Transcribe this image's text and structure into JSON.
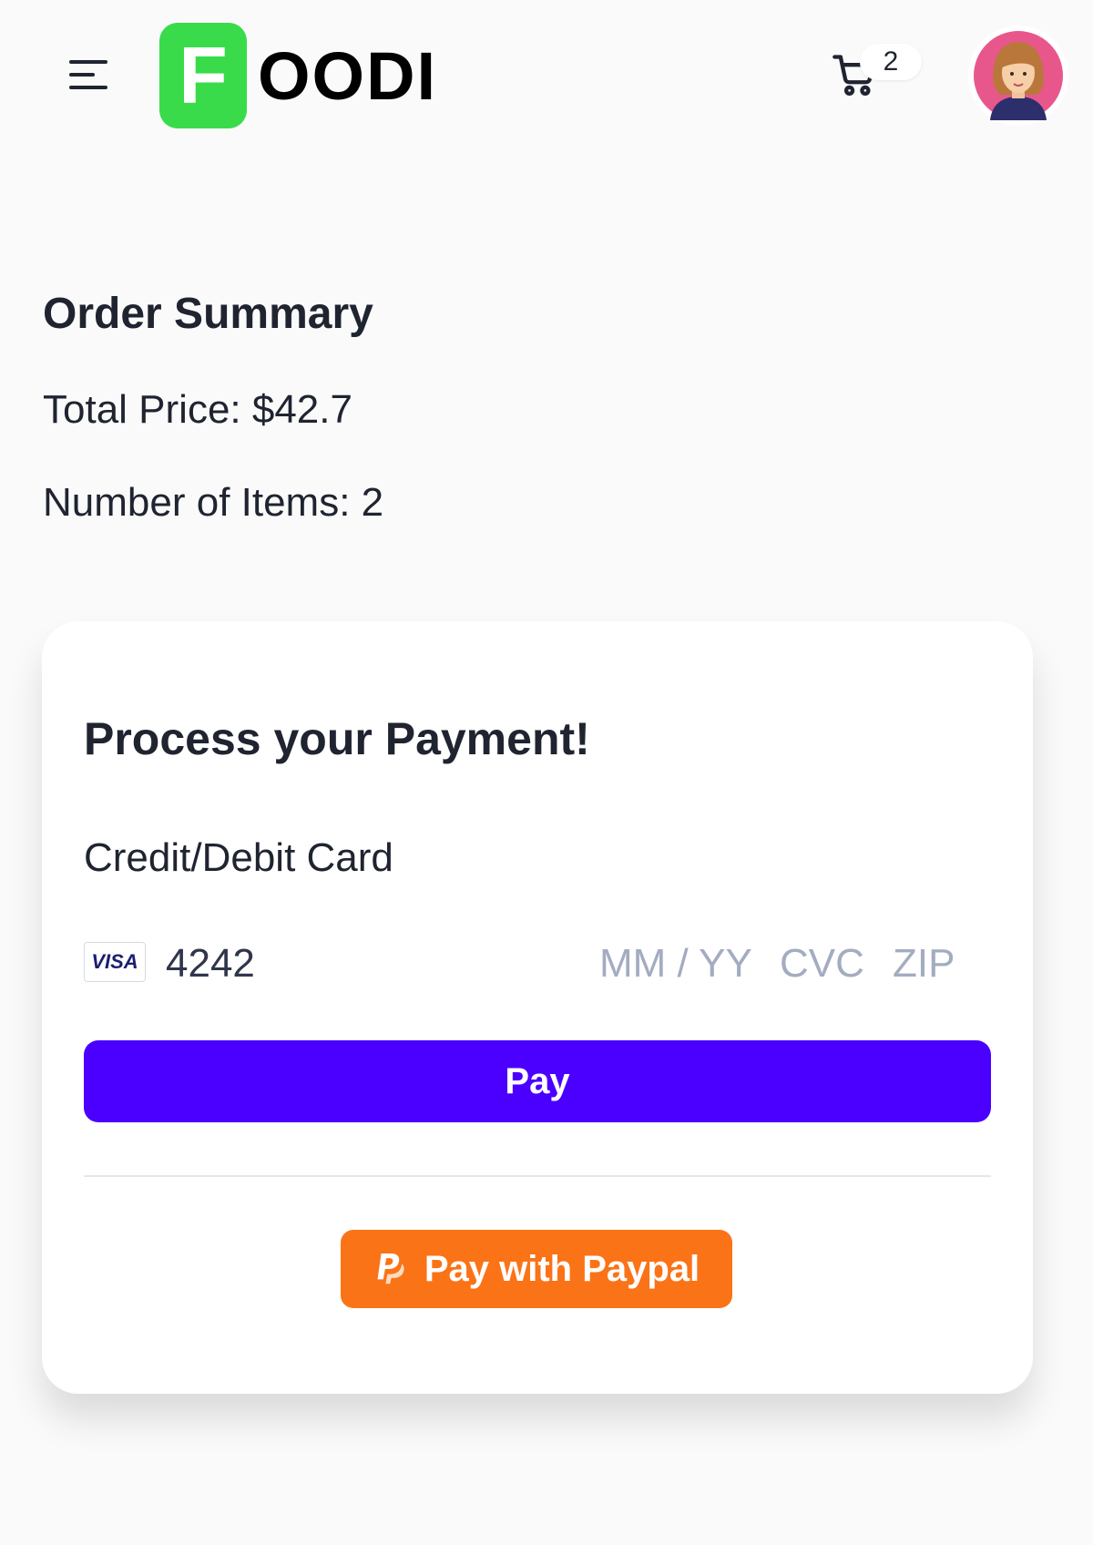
{
  "header": {
    "menu_icon": "hamburger-menu-icon",
    "logo": {
      "mark": "F",
      "text": "OODI",
      "mark_color": "#39db4a"
    },
    "cart": {
      "icon": "shopping-cart-icon",
      "count": "2"
    },
    "avatar_icon": "user-avatar"
  },
  "summary": {
    "title": "Order Summary",
    "total_price": "Total Price: $42.7",
    "item_count": "Number of Items: 2"
  },
  "payment": {
    "title": "Process your Payment!",
    "subtitle": "Credit/Debit Card",
    "card": {
      "brand": "VISA",
      "number": "4242",
      "expiry_placeholder": "MM / YY",
      "cvc_placeholder": "CVC",
      "zip_placeholder": "ZIP"
    },
    "pay_label": "Pay",
    "pay_color": "#4b00ff",
    "paypal_label": "Pay with Paypal",
    "paypal_icon": "paypal-icon",
    "paypal_color": "#fb7317"
  }
}
